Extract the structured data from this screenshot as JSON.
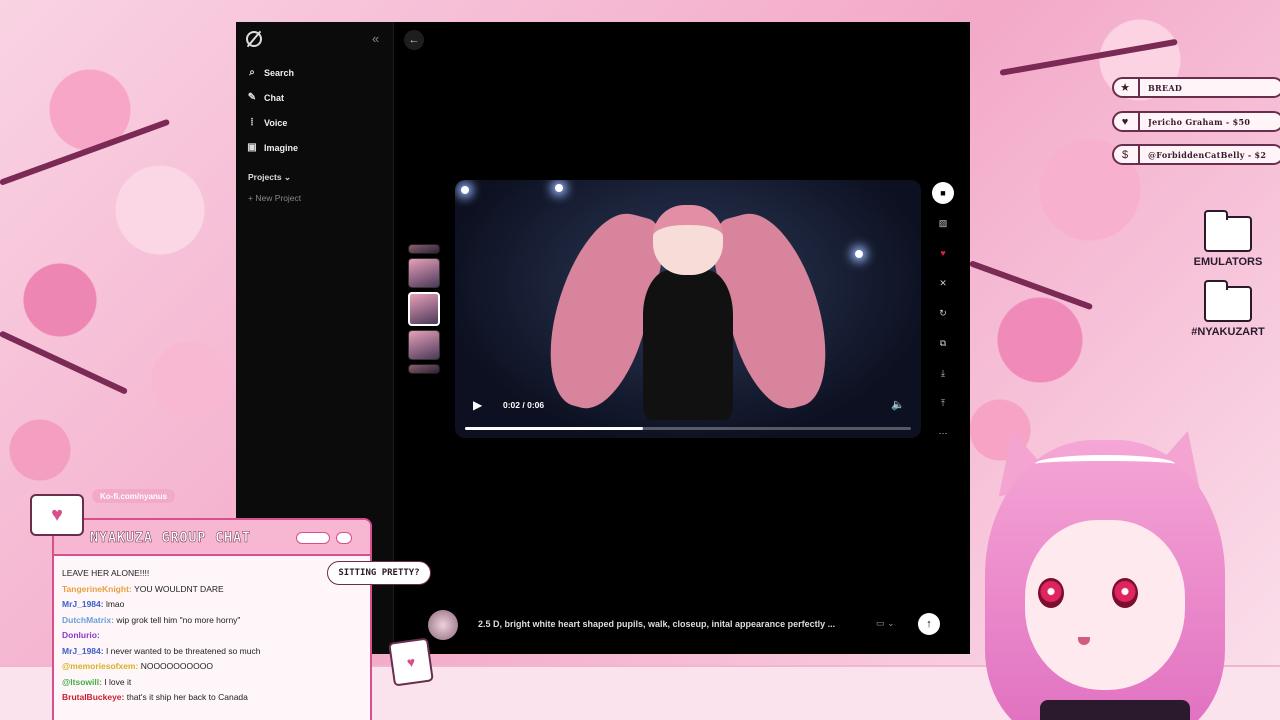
{
  "sidebar": {
    "nav": [
      {
        "label": "Search",
        "icon": "search-icon"
      },
      {
        "label": "Chat",
        "icon": "chat-icon"
      },
      {
        "label": "Voice",
        "icon": "voice-icon"
      },
      {
        "label": "Imagine",
        "icon": "imagine-icon"
      }
    ],
    "projects_label": "Projects",
    "new_project_label": "New Project"
  },
  "video": {
    "time": "0:02 / 0:06",
    "progress": 0.4
  },
  "prompt": {
    "text": "2.5 D, bright white heart shaped pupils, walk, closeup, inital appearance perfectly ..."
  },
  "alerts": [
    {
      "icon": "★",
      "text": "BREAD"
    },
    {
      "icon": "♥",
      "text": "Jericho Graham - $50"
    },
    {
      "icon": "$",
      "text": "@ForbiddenCatBelly - $2"
    }
  ],
  "folders": [
    "EMULATORS",
    "#NYAKUZART"
  ],
  "chat": {
    "kofi": "Ko-fi.com/nyanus",
    "title": "NYAKUZA GROUP CHAT",
    "sitting": "SITTING PRETTY?",
    "lines": [
      {
        "user": "",
        "text": "LEAVE HER ALONE!!!!",
        "color": "#222"
      },
      {
        "user": "TangerineKnight:",
        "text": "YOU WOULDNT DARE",
        "color": "#e8a040"
      },
      {
        "user": "MrJ_1984:",
        "text": "lmao",
        "color": "#3a60c8"
      },
      {
        "user": "DutchMatrix:",
        "text": "wip grok tell him \"no more horny\"",
        "color": "#6a9fd8"
      },
      {
        "user": "Donlurio:",
        "text": "",
        "color": "#8a3ac8"
      },
      {
        "user": "MrJ_1984:",
        "text": "I never wanted to be threatened so much",
        "color": "#3a60c8"
      },
      {
        "user": "@memoriesofxem:",
        "text": "NOOOOOOOOOO",
        "color": "#d8b020"
      },
      {
        "user": "@ltsowill:",
        "text": "I love it",
        "color": "#40b040"
      },
      {
        "user": "BrutalBuckeye:",
        "text": "that's it ship her back to Canada",
        "color": "#c82030"
      }
    ]
  }
}
